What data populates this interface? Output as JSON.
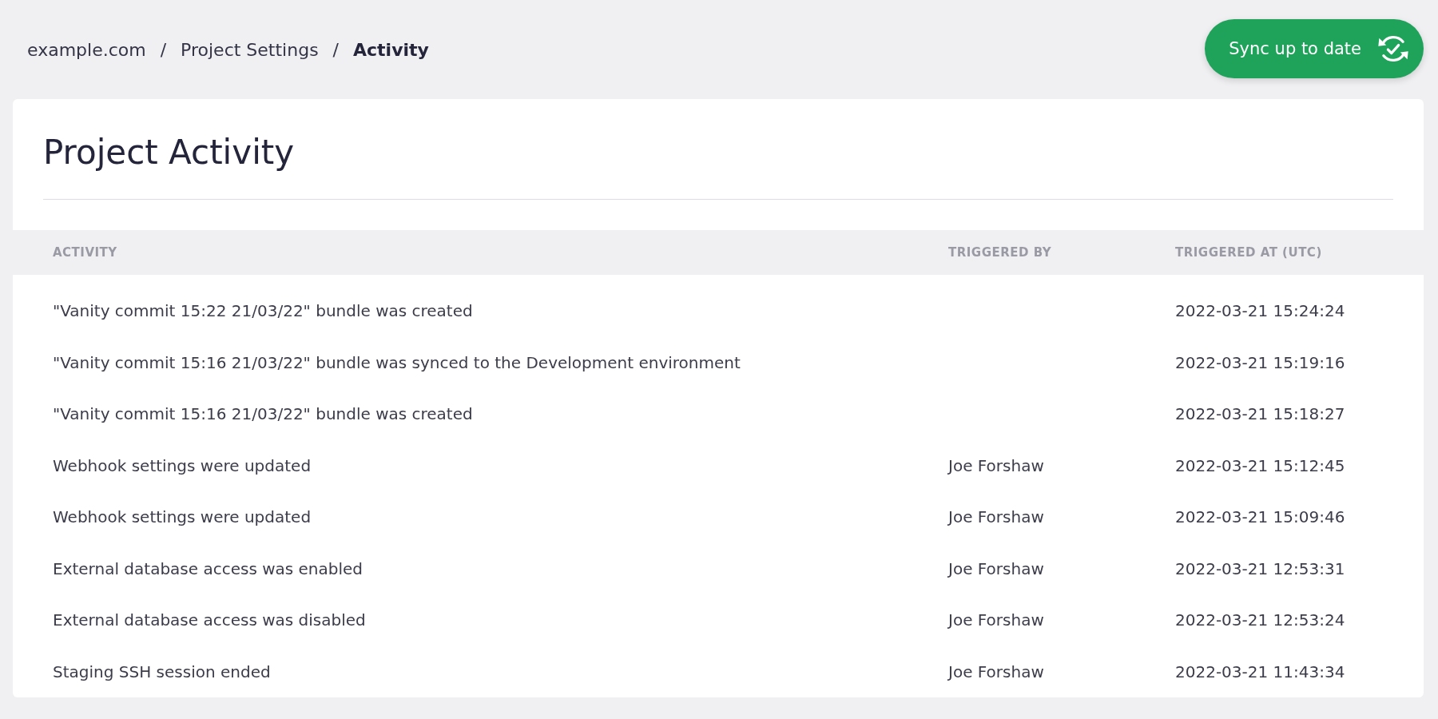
{
  "breadcrumb": [
    {
      "kind": "link",
      "label": "example.com"
    },
    {
      "kind": "separator",
      "label": "/"
    },
    {
      "kind": "link",
      "label": "Project Settings"
    },
    {
      "kind": "separator",
      "label": "/"
    },
    {
      "kind": "current",
      "label": "Activity"
    }
  ],
  "sync_button": {
    "label": "Sync up to date"
  },
  "card": {
    "title": "Project Activity"
  },
  "table": {
    "columns": [
      "ACTIVITY",
      "TRIGGERED BY",
      "TRIGGERED AT (UTC)"
    ],
    "rows": [
      {
        "activity": "\"Vanity commit 15:22 21/03/22\" bundle was created",
        "triggered_at": "2022-03-21 15:24:24"
      },
      {
        "activity": "\"Vanity commit 15:16 21/03/22\" bundle was synced to the Development environment",
        "triggered_at": "2022-03-21 15:19:16"
      },
      {
        "activity": "\"Vanity commit 15:16 21/03/22\" bundle was created",
        "triggered_at": "2022-03-21 15:18:27"
      },
      {
        "activity": "Webhook settings were updated",
        "triggered_by": "Joe Forshaw",
        "triggered_at": "2022-03-21 15:12:45"
      },
      {
        "activity": "Webhook settings were updated",
        "triggered_by": "Joe Forshaw",
        "triggered_at": "2022-03-21 15:09:46"
      },
      {
        "activity": "External database access was enabled",
        "triggered_by": "Joe Forshaw",
        "triggered_at": "2022-03-21 12:53:31"
      },
      {
        "activity": "External database access was disabled",
        "triggered_by": "Joe Forshaw",
        "triggered_at": "2022-03-21 12:53:24"
      },
      {
        "activity": "Staging SSH session ended",
        "triggered_by": "Joe Forshaw",
        "triggered_at": "2022-03-21 11:43:34"
      }
    ]
  }
}
